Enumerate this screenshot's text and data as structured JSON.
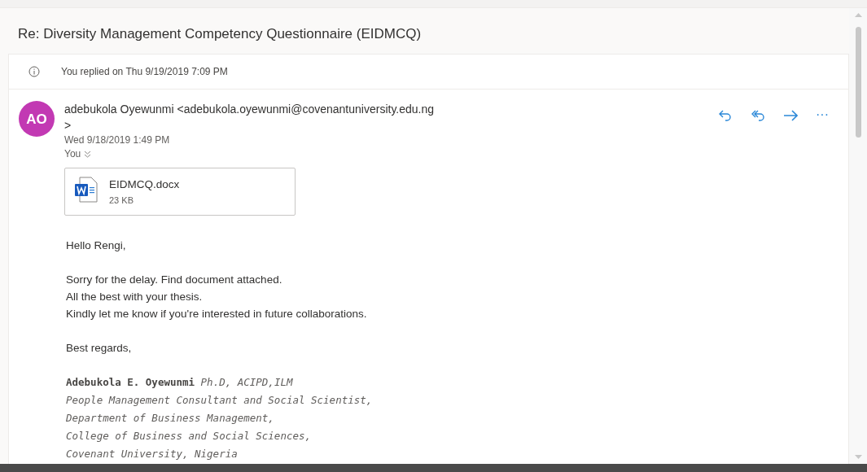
{
  "subject": "Re: Diversity Management Competency Questionnaire (EIDMCQ)",
  "info_bar": {
    "text": "You replied on Thu 9/19/2019 7:09 PM"
  },
  "message": {
    "avatar_initials": "AO",
    "color": "#c239b3",
    "sender": "adebukola Oyewunmi <adebukola.oyewunmi@covenantuniversity.edu.ng>",
    "date": "Wed 9/18/2019 1:49 PM",
    "recipients": "You",
    "actions": [
      {
        "kind": "reply"
      },
      {
        "kind": "reply_all"
      },
      {
        "kind": "forward"
      },
      {
        "kind": "more",
        "label": "···"
      }
    ],
    "attachment": {
      "name": "EIDMCQ.docx",
      "size": "23 KB"
    },
    "body": [
      [
        "Hello Rengi,"
      ],
      [
        "Sorry for the delay. Find document attached.",
        "All the best with your thesis.",
        "Kindly let me know if you're interested in future collaborations."
      ],
      [
        "Best regards,"
      ]
    ],
    "signature": [
      "**Adebukola E. Oyewunmi** *Ph.D, ACIPD,ILM*",
      "People Management Consultant and Social Scientist,",
      "Department of Business Management,",
      "College of Business and Social Sciences,",
      "Covenant University, Nigeria"
    ]
  }
}
